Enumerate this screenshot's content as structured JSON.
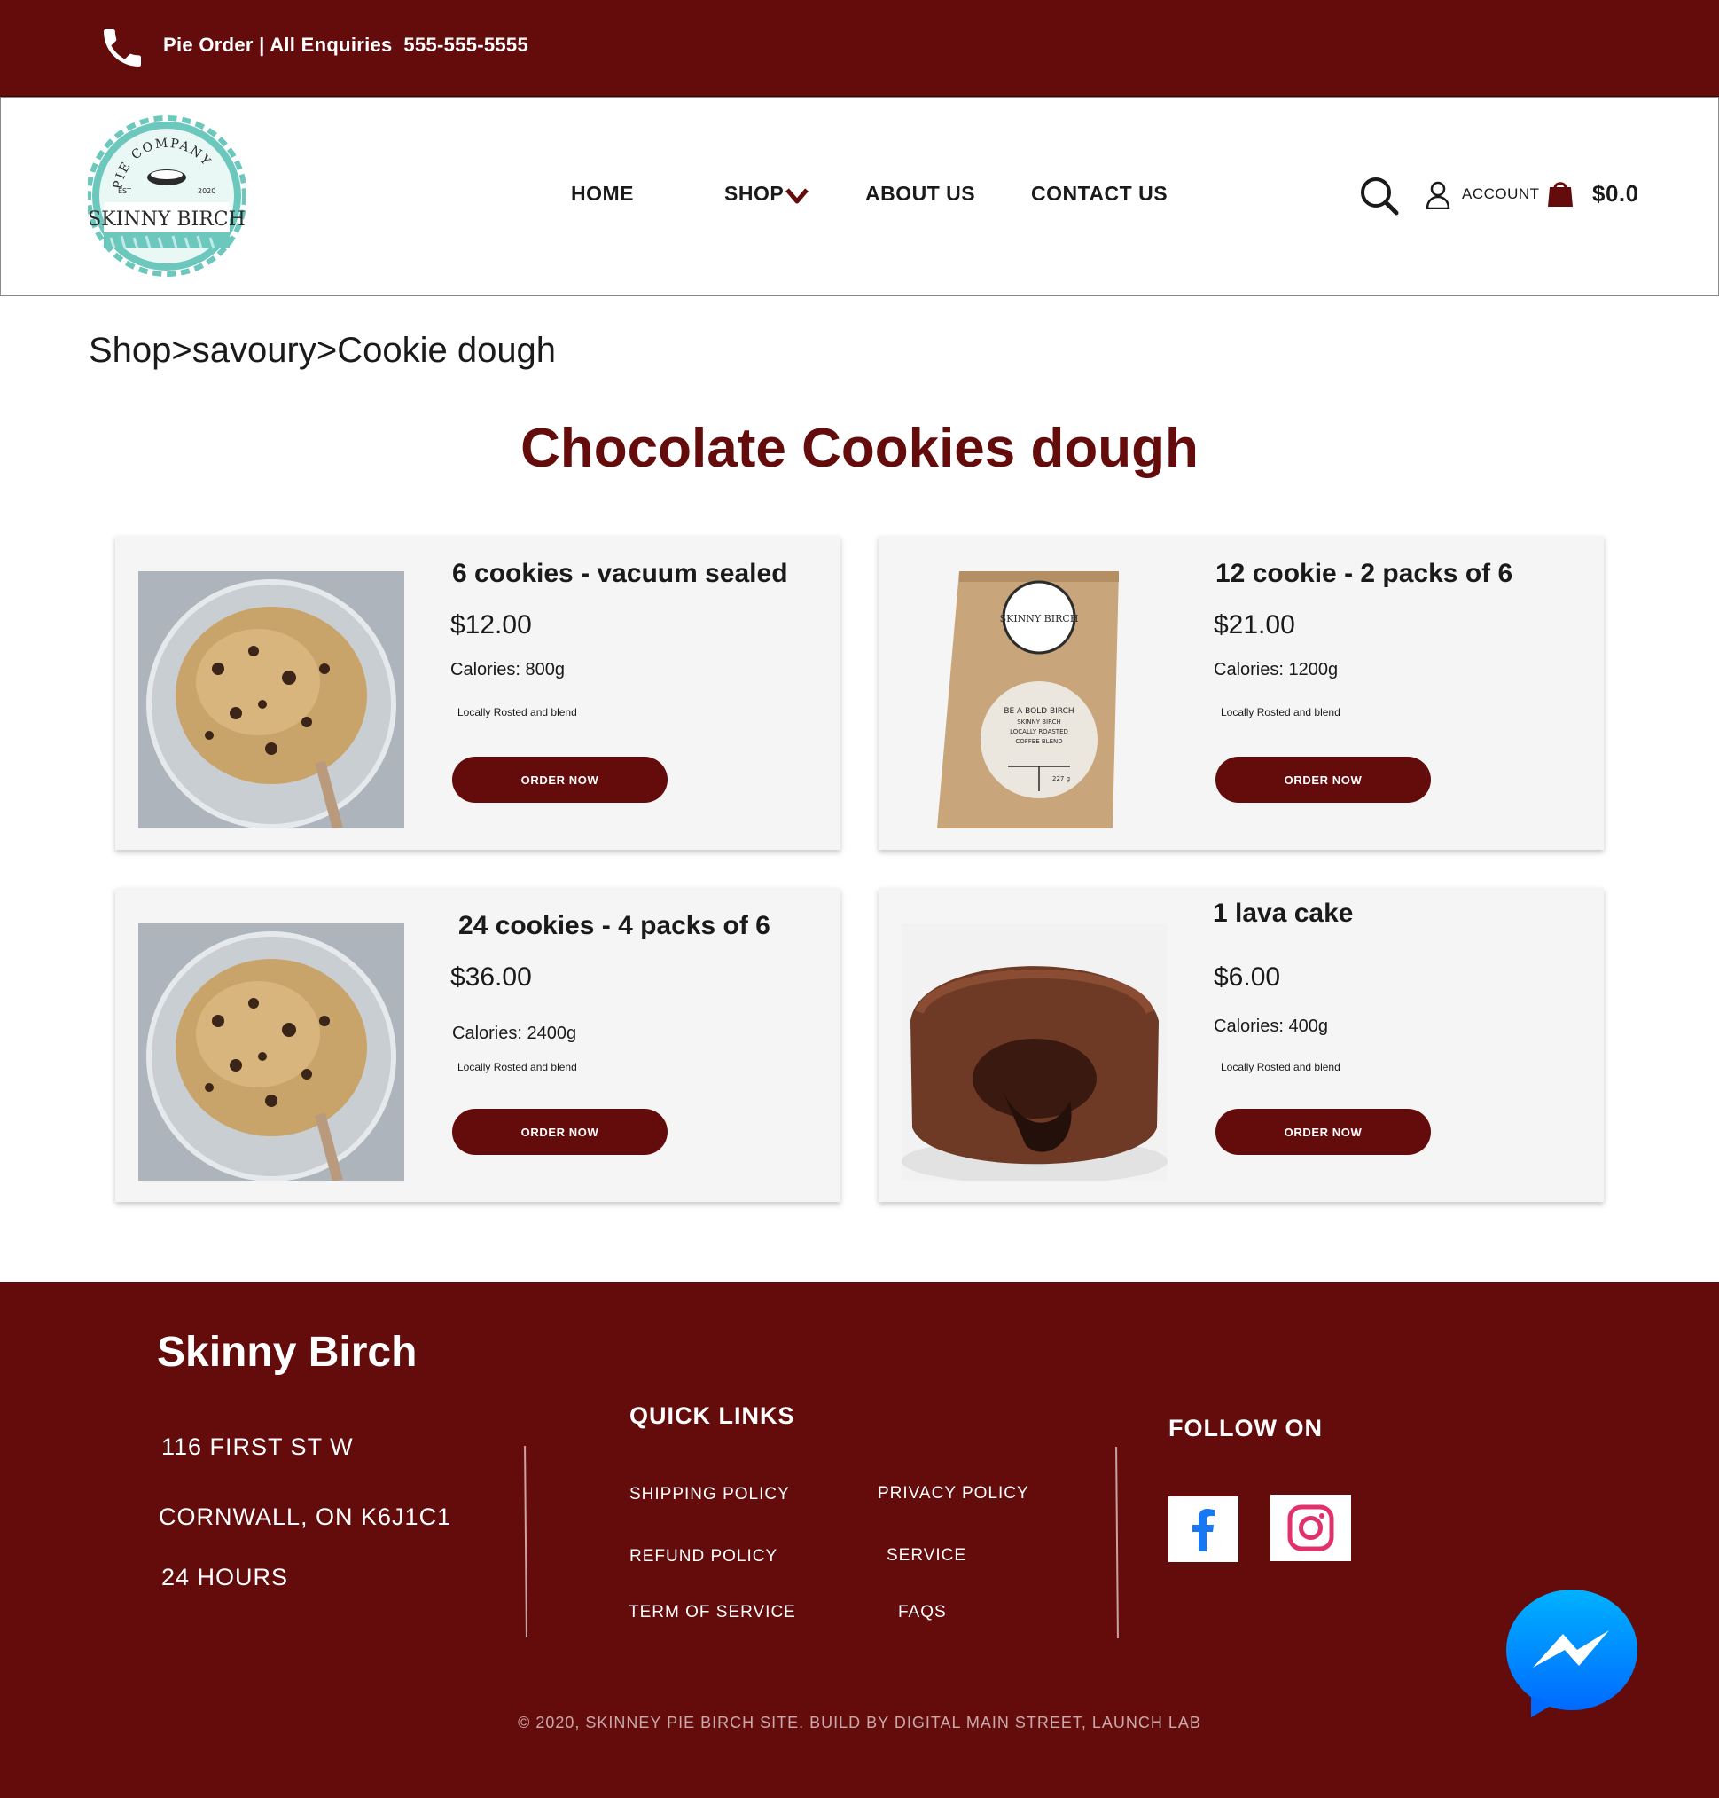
{
  "topbar": {
    "phone_label": "Pie Order | All Enquiries  555-555-5555",
    "phone_icon": "phone-icon"
  },
  "header": {
    "logo": {
      "arc_text": "PIE COMPANY",
      "est": "EST",
      "year": "2020",
      "name": "SKINNY BIRCH"
    },
    "nav": {
      "home": "HOME",
      "shop": "SHOP",
      "about": "ABOUT US",
      "contact": "CONTACT US"
    },
    "account_label": "ACCOUNT",
    "cart_total": "$0.0",
    "icons": [
      "search-icon",
      "account-icon",
      "shopping-bag-icon",
      "chevron-down-icon"
    ]
  },
  "breadcrumb": "Shop>savoury>Cookie dough",
  "page_title": "Chocolate Cookies dough",
  "products": [
    {
      "name": "6 cookies - vacuum sealed",
      "price": "$12.00",
      "calories": "Calories: 800g",
      "note": "Locally Rosted and blend",
      "button": "ORDER NOW",
      "image": "cookie-dough-bowl"
    },
    {
      "name": "12 cookie - 2 packs of 6",
      "price": "$21.00",
      "calories": "Calories: 1200g",
      "note": "Locally Rosted and blend",
      "button": "ORDER NOW",
      "image": "kraft-coffee-bag",
      "bag_label": {
        "brand": "SKINNY BIRCH",
        "line1": "BE A BOLD BIRCH",
        "line2": "SKINNY BIRCH",
        "line3": "LOCALLY ROASTED",
        "line4": "COFFEE BLEND",
        "weight": "227 g"
      }
    },
    {
      "name": "24 cookies - 4 packs of 6",
      "price": "$36.00",
      "calories": "Calories: 2400g",
      "note": "Locally Rosted and blend",
      "button": "ORDER NOW",
      "image": "cookie-dough-bowl"
    },
    {
      "name": "1 lava cake",
      "price": "$6.00",
      "calories": "Calories: 400g",
      "note": "Locally Rosted and blend",
      "button": "ORDER NOW",
      "image": "chocolate-lava-cake"
    }
  ],
  "footer": {
    "brand": "Skinny Birch",
    "address_line1": "116 FIRST ST W",
    "address_line2": "CORNWALL, ON K6J1C1",
    "hours": "24 HOURS",
    "quick_links_heading": "QUICK LINKS",
    "quick_links": [
      "SHIPPING POLICY",
      "PRIVACY POLICY",
      "REFUND POLICY",
      "SERVICE",
      "TERM OF SERVICE",
      "FAQS"
    ],
    "follow_heading": "FOLLOW ON",
    "social_icons": [
      "facebook-icon",
      "instagram-icon"
    ],
    "copyright": "© 2020, SKINNEY PIE BIRCH SITE. BUILD BY DIGITAL MAIN STREET, LAUNCH LAB"
  },
  "colors": {
    "brand_maroon": "#640b0c",
    "logo_teal": "#6cc7bd",
    "card_bg": "#f5f5f5",
    "facebook_blue": "#1877f2",
    "instagram_pink": "#e1306c",
    "messenger_blue": "#0a84ff"
  }
}
